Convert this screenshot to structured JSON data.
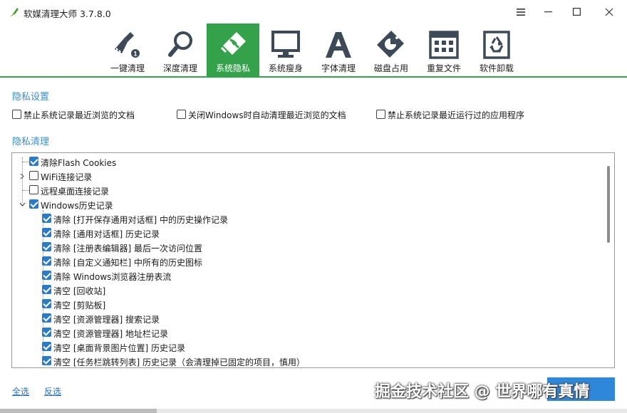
{
  "window": {
    "title": "软媒清理大师 3.7.8.0",
    "controls": {
      "menu": "menu-icon",
      "minimize": "minimize-icon",
      "maximize": "maximize-icon",
      "close": "close-icon"
    }
  },
  "colors": {
    "accent_green": "#33a24b",
    "section_blue": "#3a8fc7",
    "link_blue": "#2a6fc0",
    "checkbox_blue": "#2a7cc7",
    "button_blue": "#2e87d8"
  },
  "toolbar": {
    "active_index": 2,
    "items": [
      {
        "label": "一键清理",
        "icon": "broom-icon"
      },
      {
        "label": "深度清理",
        "icon": "magnifier-icon"
      },
      {
        "label": "系统隐私",
        "icon": "eraser-icon"
      },
      {
        "label": "系统瘦身",
        "icon": "monitor-icon"
      },
      {
        "label": "字体清理",
        "icon": "font-icon"
      },
      {
        "label": "磁盘占用",
        "icon": "disk-icon"
      },
      {
        "label": "重复文件",
        "icon": "duplicate-file-icon"
      },
      {
        "label": "软件卸载",
        "icon": "recycle-icon"
      }
    ]
  },
  "privacy_settings": {
    "title": "隐私设置",
    "options": [
      {
        "label": "禁止系统记录最近浏览的文档",
        "checked": false
      },
      {
        "label": "关闭Windows时自动清理最近浏览的文档",
        "checked": false
      },
      {
        "label": "禁止系统记录最近运行过的应用程序",
        "checked": false
      }
    ]
  },
  "privacy_clean": {
    "title": "隐私清理",
    "tree": [
      {
        "label": "清除Flash Cookies",
        "checked": true,
        "level": 0,
        "expander": "none"
      },
      {
        "label": "WiFi连接记录",
        "checked": false,
        "level": 0,
        "expander": "collapsed"
      },
      {
        "label": "远程桌面连接记录",
        "checked": false,
        "level": 0,
        "expander": "none"
      },
      {
        "label": "Windows历史记录",
        "checked": true,
        "level": 0,
        "expander": "expanded"
      },
      {
        "label": "清除 [打开保存通用对话框] 中的历史操作记录",
        "checked": true,
        "level": 1
      },
      {
        "label": "清除 [通用对话框] 历史记录",
        "checked": true,
        "level": 1
      },
      {
        "label": "清除 [注册表编辑器] 最后一次访问位置",
        "checked": true,
        "level": 1
      },
      {
        "label": "清除 [自定义通知栏] 中所有的历史图标",
        "checked": true,
        "level": 1
      },
      {
        "label": "清除 Windows浏览器注册表流",
        "checked": true,
        "level": 1
      },
      {
        "label": "清空 [回收站]",
        "checked": true,
        "level": 1
      },
      {
        "label": "清空 [剪贴板]",
        "checked": true,
        "level": 1
      },
      {
        "label": "清空 [资源管理器] 搜索记录",
        "checked": true,
        "level": 1
      },
      {
        "label": "清空 [资源管理器] 地址栏记录",
        "checked": true,
        "level": 1
      },
      {
        "label": "清空 [桌面背景图片位置] 历史记录",
        "checked": true,
        "level": 1
      },
      {
        "label": "清空 [任务栏跳转列表] 历史记录（会清理掉已固定的项目，慎用）",
        "checked": true,
        "level": 1
      }
    ]
  },
  "footer": {
    "select_all": "全选",
    "invert_selection": "反选",
    "watermark": "掘金技术社区 @ 世界哪有真情"
  }
}
